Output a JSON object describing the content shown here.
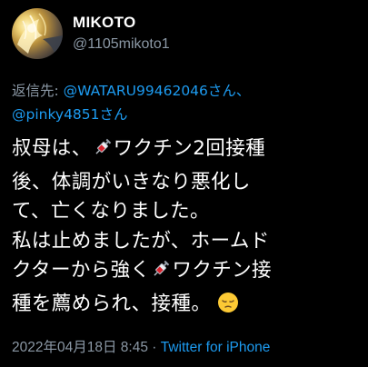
{
  "user": {
    "display_name": "MIKOTO",
    "handle": "@1105mikoto1"
  },
  "reply": {
    "prefix": "返信先: ",
    "mention_1": "@WATARU99462046さん、",
    "mention_2": "@pinky4851さん"
  },
  "tweet": {
    "line1_a": "叔母は、",
    "line1_b": "ワクチン2回接種",
    "line2": "後、体調がいきなり悪化し",
    "line3": "て、亡くなりました。",
    "line4": "私は止めましたが、ホームド",
    "line5_a": "クターから強く",
    "line5_b": "ワクチン接",
    "line6": "種を薦められ、接種。",
    "syringe_icon": "syringe-emoji",
    "pensive_icon": "pensive-face-emoji"
  },
  "meta": {
    "date": "2022年04月18日 8:45",
    "separator": " · ",
    "source": "Twitter for iPhone"
  },
  "colors": {
    "background": "#000000",
    "text": "#ffffff",
    "secondary": "#8b98a5",
    "link": "#1d9bf0"
  }
}
